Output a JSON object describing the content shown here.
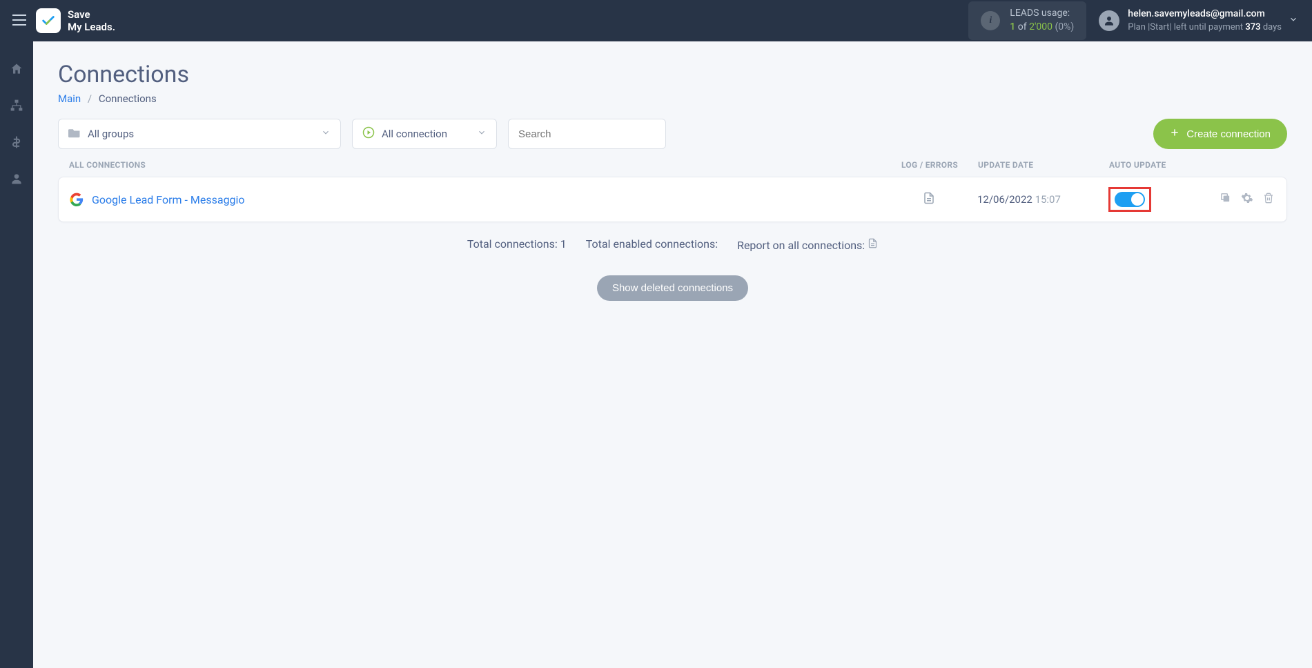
{
  "header": {
    "logo_line1": "Save",
    "logo_line2": "My Leads.",
    "usage_label": "LEADS usage:",
    "usage_used": "1",
    "usage_of": "of",
    "usage_limit": "2'000",
    "usage_pct": "(0%)",
    "account_email": "helen.savemyleads@gmail.com",
    "plan_text_1": "Plan |Start| left until payment ",
    "plan_days": "373",
    "plan_text_2": " days"
  },
  "page": {
    "title": "Connections",
    "breadcrumb_main": "Main",
    "breadcrumb_current": "Connections"
  },
  "filters": {
    "groups_label": "All groups",
    "conn_label": "All connection",
    "search_placeholder": "Search",
    "create_label": "Create connection"
  },
  "table": {
    "col_all": "ALL CONNECTIONS",
    "col_log": "LOG / ERRORS",
    "col_date": "UPDATE DATE",
    "col_auto": "AUTO UPDATE"
  },
  "rows": [
    {
      "name": "Google Lead Form - Messaggio",
      "date": "12/06/2022",
      "time": "15:07",
      "auto": true
    }
  ],
  "summary": {
    "total_conn_label": "Total connections: ",
    "total_conn_value": "1",
    "total_enabled_label": "Total enabled connections:",
    "report_label": "Report on all connections:"
  },
  "buttons": {
    "show_deleted": "Show deleted connections"
  }
}
